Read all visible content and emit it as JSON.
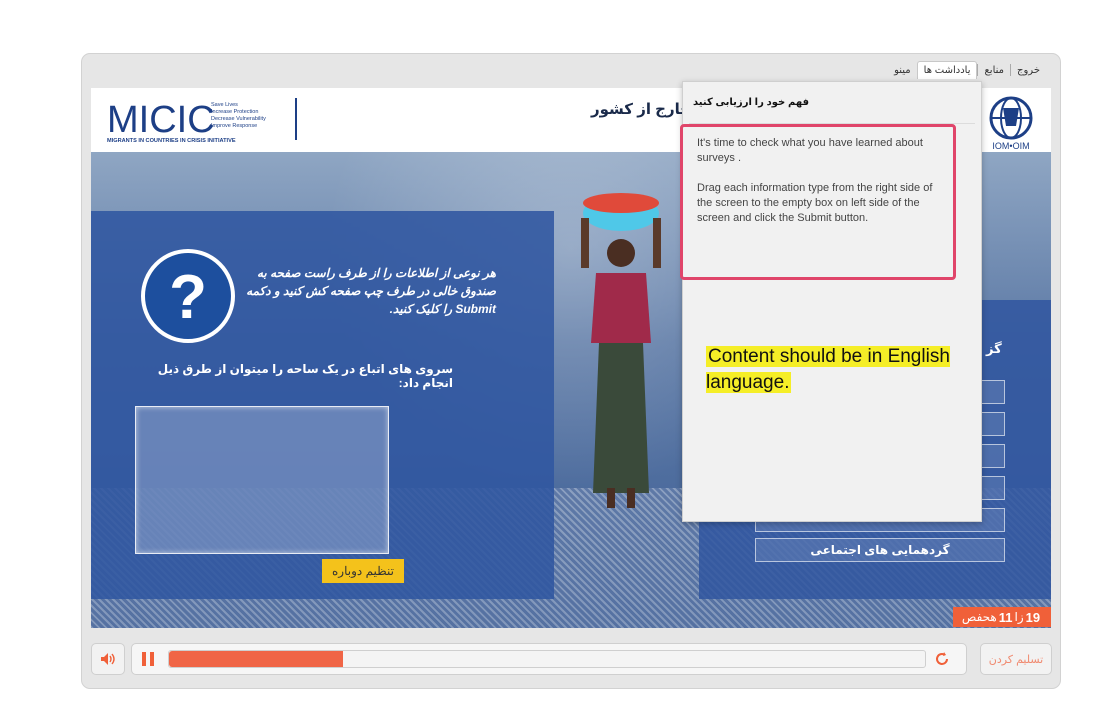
{
  "nav": {
    "tabs": [
      "خروج",
      "منابع",
      "یادداشت ها",
      "مینو"
    ],
    "active_tab": "یادداشت ها"
  },
  "header": {
    "title": "خارج از کشور",
    "logo_left": {
      "name": "MICIC",
      "taglines": [
        "Save Lives",
        "Increase Protection",
        "Decrease Vulnerability",
        "Improve Response"
      ],
      "subtitle": "MIGRANTS IN COUNTRIES IN CRISIS INITIATIVE"
    },
    "logo_right": {
      "name": "IOM•OIM"
    }
  },
  "left_panel": {
    "instruction": "هر نوعی از اطلاعات را از طرف راست صفحه به صندوق خالی در طرف چپ صفحه کش کنید و دکمه Submit را کلیک کنید.",
    "question": "سروی های اتباع در یک ساحه را میتوان از طرق ذیل انجام داد:",
    "reset_label": "تنظیم دوباره"
  },
  "right_panel": {
    "partial_label": "گز",
    "options": [
      "",
      "",
      "",
      "",
      "",
      "گردهمایی های اجتماعی"
    ]
  },
  "notes": {
    "title": "فهم خود را ارزیابی کنید",
    "body_1": "It's time to check what you have learned about surveys .",
    "body_2": "Drag each information type from the right side of the screen to the empty box on left side of the screen and click the Submit button."
  },
  "annotation": {
    "text": "Content should be in English language."
  },
  "slide_counter": {
    "current": "19",
    "separator": "زا",
    "total": "11",
    "suffix": "هحفص"
  },
  "player": {
    "progress": 0.23,
    "submit_label": "تسلیم کردن"
  },
  "colors": {
    "accent": "#f06039",
    "panel": "#3056a0",
    "highlight": "#f5ee27",
    "reset": "#f4c21b"
  },
  "icons": [
    "question-icon",
    "volume-icon",
    "pause-icon",
    "replay-icon",
    "iom-globe-icon"
  ]
}
